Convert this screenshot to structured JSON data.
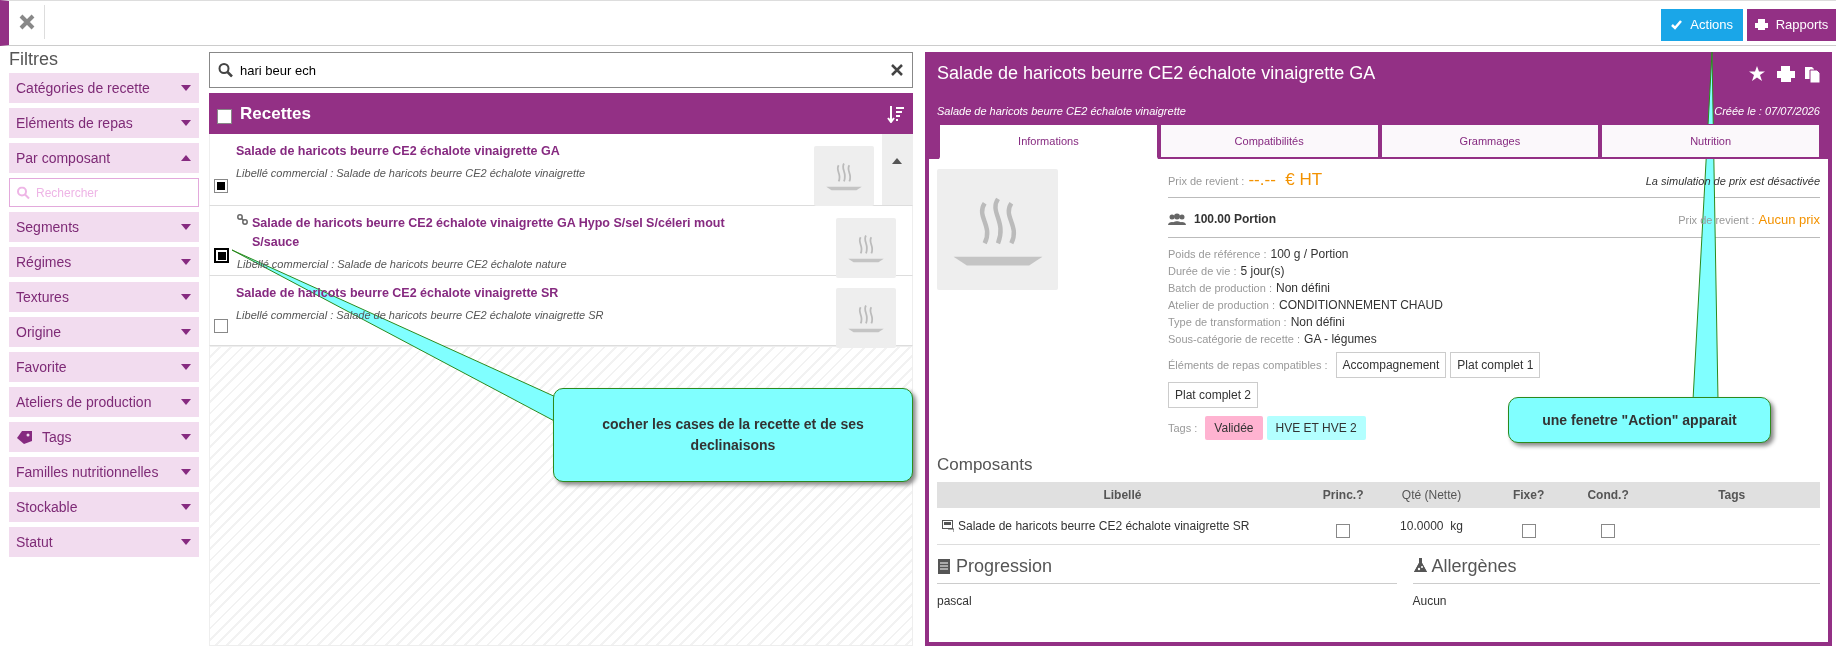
{
  "topbar": {
    "buttons": [
      {
        "label": "Actions",
        "kind": "actions"
      },
      {
        "label": "Rapports",
        "kind": "reports"
      }
    ]
  },
  "filters": {
    "title": "Filtres",
    "items": [
      {
        "label": "Catégories de recette",
        "kind": "plain",
        "expanded": false
      },
      {
        "label": "Eléments de repas",
        "kind": "plain",
        "expanded": false
      },
      {
        "label": "Par composant",
        "kind": "plain",
        "expanded": true,
        "placeholder": "Rechercher"
      },
      {
        "label": "Segments",
        "kind": "plain",
        "expanded": false
      },
      {
        "label": "Régimes",
        "kind": "plain",
        "expanded": false
      },
      {
        "label": "Textures",
        "kind": "plain",
        "expanded": false
      },
      {
        "label": "Origine",
        "kind": "plain",
        "expanded": false
      },
      {
        "label": "Favorite",
        "kind": "plain",
        "expanded": false
      },
      {
        "label": "Ateliers de production",
        "kind": "plain",
        "expanded": false
      },
      {
        "label": "Tags",
        "kind": "tag",
        "expanded": false
      },
      {
        "label": "Familles nutritionnelles",
        "kind": "plain",
        "expanded": false
      },
      {
        "label": "Stockable",
        "kind": "plain",
        "expanded": false
      },
      {
        "label": "Statut",
        "kind": "plain",
        "expanded": false
      }
    ]
  },
  "recipes": {
    "search": {
      "value": "hari beur ech"
    },
    "title": "Recettes",
    "select_all_checked": false,
    "rows": [
      {
        "title": "Salade de haricots beurre CE2 échalote vinaigrette GA",
        "subtitle": "Libellé commercial : Salade de haricots beurre CE2 échalote vinaigrette",
        "kind": "recipe",
        "checked": true,
        "focused": false
      },
      {
        "title": "Salade de haricots beurre CE2 échalote vinaigrette GA Hypo S/sel S/céleri mout S/sauce",
        "subtitle": "Libellé commercial : Salade de haricots beurre CE2 échalote nature",
        "kind": "variant",
        "checked": true,
        "focused": true
      },
      {
        "title": "Salade de haricots beurre CE2 échalote vinaigrette SR",
        "subtitle": "Libellé commercial : Salade de haricots beurre CE2 échalote vinaigrette SR",
        "kind": "recipe",
        "checked": false,
        "focused": false
      }
    ]
  },
  "detail": {
    "title": "Salade de haricots beurre CE2 échalote vinaigrette GA",
    "subtitle": "Salade de haricots beurre CE2 échalote vinaigrette",
    "created": "Créée le : 07/07/2026",
    "tabs": [
      {
        "label": "Informations",
        "selected": true
      },
      {
        "label": "Compatibilités",
        "selected": false
      },
      {
        "label": "Grammages",
        "selected": false
      },
      {
        "label": "Nutrition",
        "selected": false
      }
    ],
    "price_label": "Prix de revient :",
    "price_value": "--.--  € HT",
    "simulation_note": "La simulation de prix est désactivée",
    "portion": "100.00 Portion",
    "portion_price_label": "Prix de revient :",
    "portion_price_value": "Aucun prix",
    "properties": [
      {
        "label": "Poids de référence :",
        "value": "100 g / Portion"
      },
      {
        "label": "Durée de vie :",
        "value": "5 jour(s)"
      },
      {
        "label": "Batch de production :",
        "value": "Non défini"
      },
      {
        "label": "Atelier de production :",
        "value": "CONDITIONNEMENT CHAUD"
      },
      {
        "label": "Type de transformation :",
        "value": "Non défini"
      },
      {
        "label": "Sous-catégorie de recette :",
        "value": "GA - légumes"
      }
    ],
    "compat_label": "Éléments de repas compatibles :",
    "compat": [
      "Accompagnement",
      "Plat complet 1",
      "Plat complet 2"
    ],
    "tags_label": "Tags :",
    "tags": [
      {
        "label": "Validée",
        "color": "#ffb3d1"
      },
      {
        "label": "HVE ET HVE 2",
        "color": "#b3ffff"
      }
    ],
    "components": {
      "title": "Composants",
      "columns": [
        "Libellé",
        "Princ.?",
        "Qté (Nette)",
        "Fixe?",
        "Cond.?",
        "Tags"
      ],
      "rows": [
        {
          "label": "Salade de haricots beurre CE2 échalote vinaigrette SR",
          "princ": false,
          "qty": "10.0000  kg",
          "fixe": false,
          "cond": false
        }
      ]
    },
    "progression": {
      "title": "Progression",
      "text": "pascal"
    },
    "allergens": {
      "title": "Allergènes",
      "text": "Aucun"
    }
  },
  "annotations": [
    {
      "text": "cocher les cases de la recette et de ses declinaisons"
    },
    {
      "text": "une fenetre \"Action\" apparait"
    }
  ]
}
